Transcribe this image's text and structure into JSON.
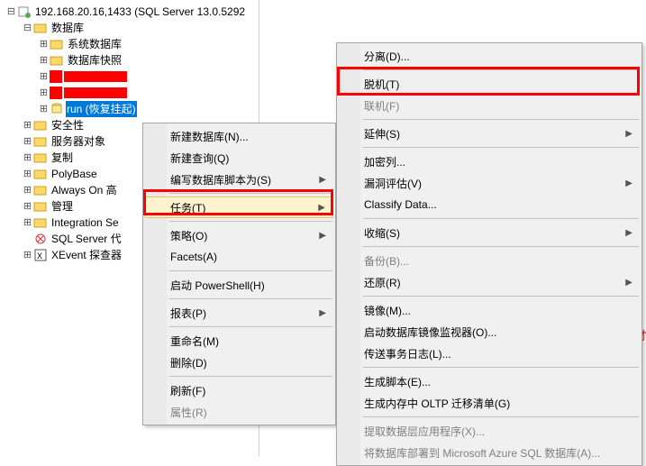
{
  "server": {
    "label": "192.168.20.16,1433 (SQL Server 13.0.5292"
  },
  "tree": {
    "databases": "数据库",
    "sysdb": "系统数据库",
    "dbsnap": "数据库快照",
    "sel_db": "run (恢复挂起)",
    "security": "安全性",
    "serverobj": "服务器对象",
    "replication": "复制",
    "polybase": "PolyBase",
    "alwayson": "Always On 高",
    "management": "管理",
    "integration": "Integration Se",
    "agent": "SQL Server 代",
    "xevent": "XEvent 探查器"
  },
  "menu1": {
    "newdb": "新建数据库(N)...",
    "newquery": "新建查询(Q)",
    "script_as": "编写数据库脚本为(S)",
    "tasks": "任务(T)",
    "policies": "策略(O)",
    "facets": "Facets(A)",
    "powershell": "启动 PowerShell(H)",
    "reports": "报表(P)",
    "rename": "重命名(M)",
    "delete": "删除(D)",
    "refresh": "刷新(F)",
    "properties": "属性(R)"
  },
  "menu2": {
    "detach": "分离(D)...",
    "offline": "脱机(T)",
    "online": "联机(F)",
    "stretch": "延伸(S)",
    "encrypt": "加密列...",
    "vuln": "漏洞评估(V)",
    "classify": "Classify Data...",
    "shrink": "收缩(S)",
    "backup": "备份(B)...",
    "restore": "还原(R)",
    "mirror": "镜像(M)...",
    "launch_monitor": "启动数据库镜像监视器(O)...",
    "ship_log": "传送事务日志(L)...",
    "gen_script": "生成脚本(E)...",
    "oltp": "生成内存中 OLTP 迁移清单(G)",
    "extract": "提取数据层应用程序(X)...",
    "deploy_azure": "将数据库部署到 Microsoft Azure SQL 数据库(A)..."
  },
  "side_text": "才"
}
